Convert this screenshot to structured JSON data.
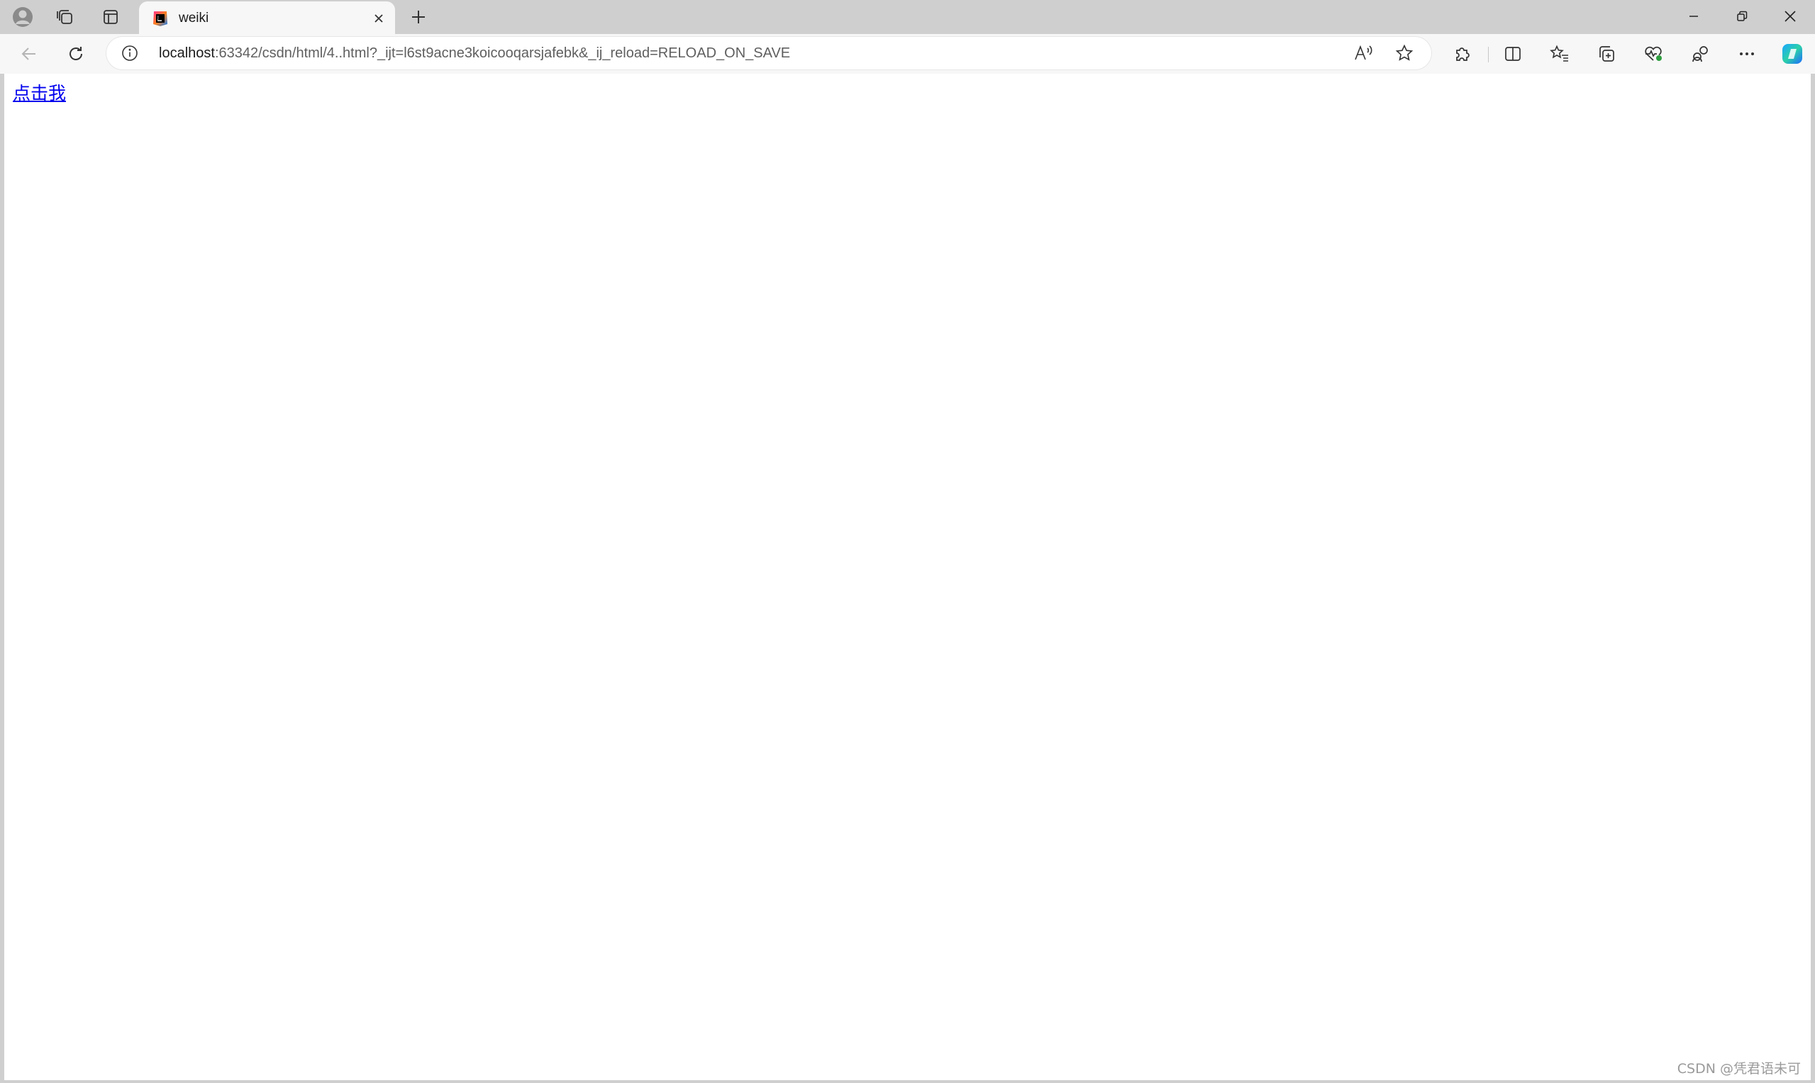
{
  "browser": {
    "tab": {
      "title": "weiki",
      "favicon": "jetbrains-icon"
    },
    "address_bar": {
      "host": "localhost",
      "rest": ":63342/csdn/html/4..html?_ijt=l6st9acne3koicooqarsjafebk&_ij_reload=RELOAD_ON_SAVE"
    },
    "icons": {
      "profile": "profile-icon",
      "workspaces": "workspaces-icon",
      "tab_actions": "vertical-tabs-icon",
      "new_tab": "plus-icon",
      "back": "back-arrow-icon",
      "refresh": "refresh-icon",
      "site_info": "info-icon",
      "read_aloud": "read-aloud-icon",
      "favorite": "star-icon",
      "extensions": "puzzle-icon",
      "split_screen": "split-screen-icon",
      "favorites": "favorites-list-icon",
      "collections": "collections-icon",
      "browser_essentials": "heart-pulse-icon",
      "share": "share-icon",
      "more": "ellipsis-icon",
      "copilot": "copilot-icon"
    },
    "colors": {
      "tab_strip": "#cfcfcf",
      "toolbar": "#f7f7f7",
      "link": "#0000ee"
    }
  },
  "page": {
    "link_text": "点击我",
    "watermark": "CSDN @凭君语未可"
  }
}
